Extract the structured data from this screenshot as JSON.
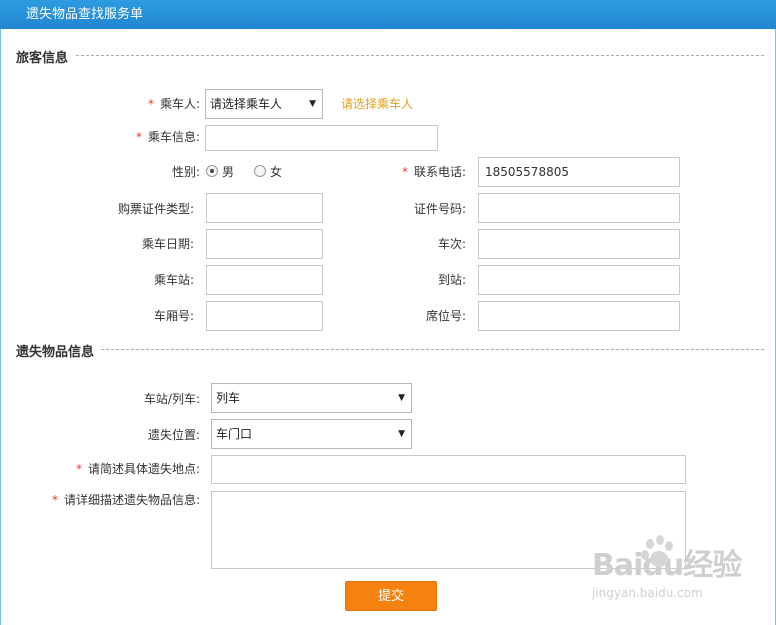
{
  "window": {
    "title": "遗失物品查找服务单"
  },
  "sections": {
    "traveler": "旅客信息",
    "lost_item": "遗失物品信息"
  },
  "traveler": {
    "passenger": {
      "label": "乘车人:",
      "value": "请选择乘车人",
      "hint": "请选择乘车人"
    },
    "passenger_info": {
      "label": "乘车信息:",
      "value": ""
    },
    "gender": {
      "label": "性别:",
      "options": [
        "男",
        "女"
      ],
      "selected": "男"
    },
    "phone": {
      "label": "联系电话:",
      "value": "18505578805"
    },
    "id_type": {
      "label": "购票证件类型:",
      "value": ""
    },
    "id_number": {
      "label": "证件号码:",
      "value": ""
    },
    "travel_date": {
      "label": "乘车日期:",
      "value": ""
    },
    "train_no": {
      "label": "车次:",
      "value": ""
    },
    "board_station": {
      "label": "乘车站:",
      "value": ""
    },
    "arrive_station": {
      "label": "到站:",
      "value": ""
    },
    "carriage_no": {
      "label": "车厢号:",
      "value": ""
    },
    "seat_no": {
      "label": "席位号:",
      "value": ""
    }
  },
  "lost": {
    "station_train": {
      "label": "车站/列车:",
      "value": "列车"
    },
    "lost_position": {
      "label": "遗失位置:",
      "value": "车门口"
    },
    "location_detail": {
      "label": "请简述具体遗失地点:",
      "value": ""
    },
    "item_detail": {
      "label": "请详细描述遗失物品信息:",
      "value": ""
    }
  },
  "submit_label": "提交",
  "required_mark": "*",
  "watermark": {
    "brand": "Baidu经验",
    "url": "jingyan.baidu.com"
  },
  "colors": {
    "titlebar": "#1f86cf",
    "accent": "#f5820f",
    "required": "#e23c3c",
    "hint": "#e0a21a"
  }
}
